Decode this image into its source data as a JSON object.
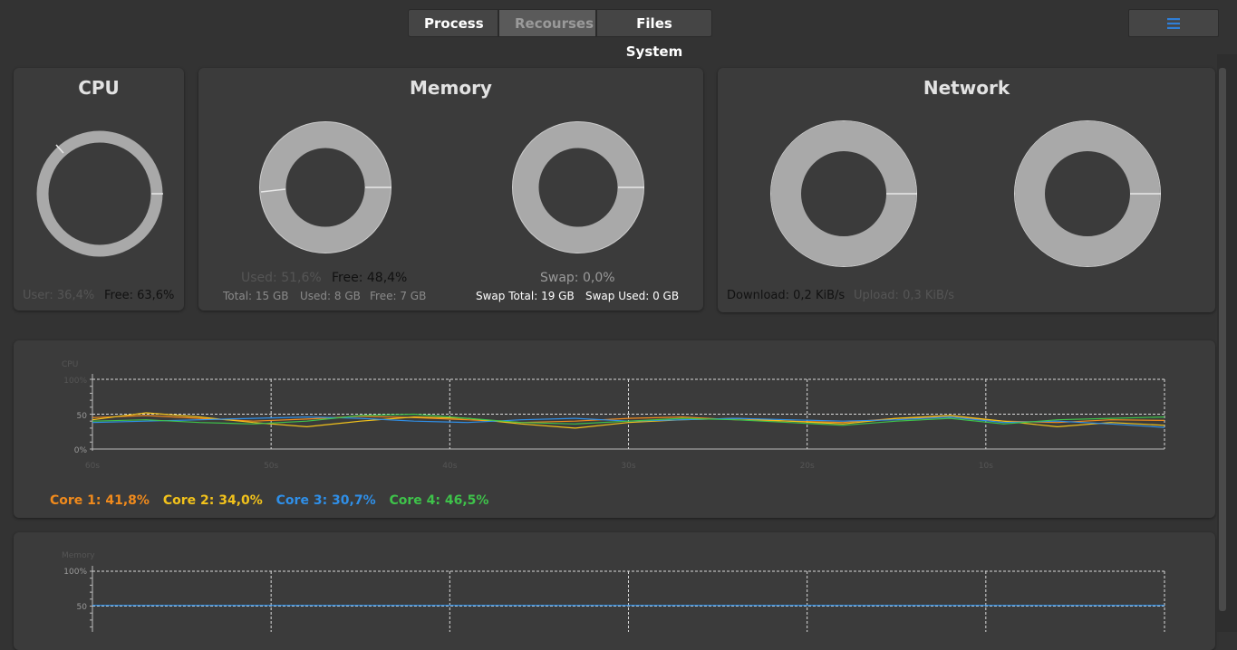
{
  "tabs": [
    {
      "label": "Process"
    },
    {
      "label": "Recourses"
    },
    {
      "label": "Files System"
    }
  ],
  "active_tab": "Recourses",
  "menu_icon": "hamburger-icon",
  "cpu": {
    "title": "CPU",
    "used_label": "User: 36,4%",
    "free_label": "Free: 63,6%",
    "used_fraction": 0.364
  },
  "memory": {
    "title": "Memory",
    "used_label": "Used: 51,6%",
    "free_label": "Free: 48,4%",
    "total_label": "Total: 15 GB",
    "used_gb_label": "Used: 8 GB",
    "free_gb_label": "Free: 7 GB",
    "swap_label": "Swap: 0,0%",
    "swap_total_label": "Swap Total: 19 GB",
    "swap_used_label": "Swap Used: 0 GB"
  },
  "network": {
    "title": "Network",
    "download_label": "Download: 0,2 KiB/s",
    "upload_label": "Upload: 0,3 KiB/s"
  },
  "cpu_chart": {
    "y_title": "CPU",
    "y_ticks": [
      "100%",
      "50",
      "0%"
    ],
    "x_ticks": [
      "60s",
      "50s",
      "40s",
      "30s",
      "20s",
      "10s"
    ],
    "legend": [
      {
        "label": "Core 1: 41,8%",
        "color": "#f08a1c"
      },
      {
        "label": "Core 2: 34,0%",
        "color": "#f2c21b"
      },
      {
        "label": "Core 3: 30,7%",
        "color": "#2f8fe8"
      },
      {
        "label": "Core 4: 46,5%",
        "color": "#3ec24a"
      }
    ]
  },
  "mem_chart": {
    "y_title": "Memory",
    "y_ticks": [
      "100%",
      "50"
    ]
  },
  "chart_data": [
    {
      "type": "line",
      "title": "",
      "xlabel": "",
      "ylabel": "CPU",
      "ylim": [
        0,
        100
      ],
      "x": [
        60,
        57,
        54,
        51,
        48,
        45,
        42,
        39,
        36,
        33,
        30,
        27,
        24,
        21,
        18,
        15,
        12,
        9,
        6,
        3,
        0
      ],
      "series": [
        {
          "name": "Core 1: 41,8%",
          "color": "#f08a1c",
          "values": [
            45,
            48,
            44,
            40,
            43,
            47,
            45,
            42,
            38,
            40,
            44,
            46,
            42,
            40,
            38,
            44,
            46,
            40,
            38,
            42,
            41
          ]
        },
        {
          "name": "Core 2: 34,0%",
          "color": "#f2c21b",
          "values": [
            42,
            52,
            46,
            38,
            32,
            40,
            46,
            44,
            36,
            30,
            38,
            42,
            44,
            40,
            36,
            44,
            48,
            40,
            32,
            38,
            34
          ]
        },
        {
          "name": "Core 3: 30,7%",
          "color": "#2f8fe8",
          "values": [
            38,
            40,
            42,
            44,
            46,
            44,
            40,
            38,
            42,
            44,
            40,
            42,
            44,
            42,
            40,
            42,
            46,
            38,
            40,
            36,
            31
          ]
        },
        {
          "name": "Core 4: 46,5%",
          "color": "#3ec24a",
          "values": [
            40,
            42,
            38,
            36,
            40,
            48,
            50,
            44,
            38,
            36,
            40,
            44,
            42,
            38,
            34,
            40,
            44,
            36,
            42,
            44,
            46
          ]
        }
      ]
    },
    {
      "type": "line",
      "title": "",
      "xlabel": "",
      "ylabel": "Memory",
      "ylim": [
        0,
        100
      ],
      "x": [
        60,
        0
      ],
      "series": [
        {
          "name": "",
          "color": "#2f8fe8",
          "values": [
            51,
            51
          ]
        }
      ]
    }
  ]
}
